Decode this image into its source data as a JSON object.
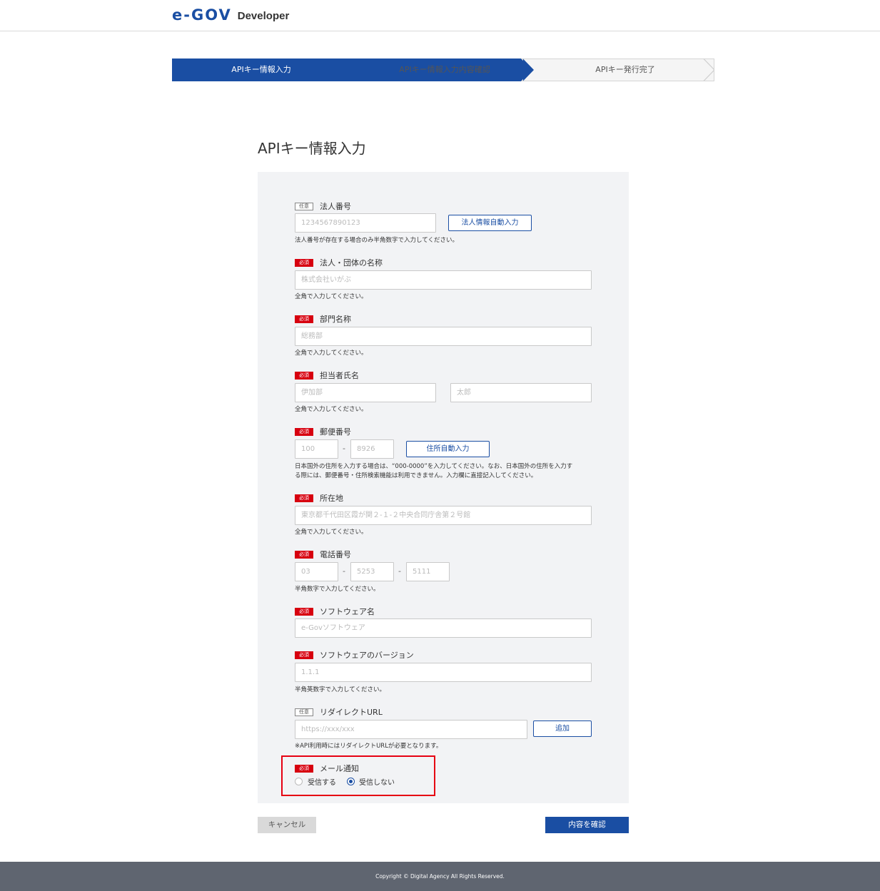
{
  "header": {
    "logo_mark": "e-GOV",
    "logo_sub": "Developer"
  },
  "stepper": {
    "steps": [
      {
        "label": "APIキー情報入力",
        "active": true
      },
      {
        "label": "APIキー情報入力内容確認",
        "active": false
      },
      {
        "label": "APIキー発行完了",
        "active": false
      }
    ]
  },
  "page_title": "APIキー情報入力",
  "badges": {
    "required": "必須",
    "optional": "任意"
  },
  "form": {
    "corporate_number": {
      "label": "法人番号",
      "placeholder": "1234567890123",
      "button": "法人情報自動入力",
      "help": "法人番号が存在する場合のみ半角数字で入力してください。"
    },
    "corporate_name": {
      "label": "法人・団体の名称",
      "placeholder": "株式会社いがぶ",
      "help": "全角で入力してください。"
    },
    "department": {
      "label": "部門名称",
      "placeholder": "総務部",
      "help": "全角で入力してください。"
    },
    "contact_name": {
      "label": "担当者氏名",
      "placeholder_last": "伊加部",
      "placeholder_first": "太郎",
      "help": "全角で入力してください。"
    },
    "postal_code": {
      "label": "郵便番号",
      "placeholder_1": "100",
      "placeholder_2": "8926",
      "separator": "-",
      "button": "住所自動入力",
      "help_1": "日本国外の住所を入力する場合は、“000-0000”を入力してください。なお、日本国外の住所を入力す",
      "help_2": "る際には、郵便番号・住所検索機能は利用できません。入力欄に直接記入してください。"
    },
    "address": {
      "label": "所在地",
      "placeholder": "東京都千代田区霞が関２-１-２中央合同庁舎第２号館",
      "help": "全角で入力してください。"
    },
    "phone": {
      "label": "電話番号",
      "placeholder_1": "03",
      "placeholder_2": "5253",
      "placeholder_3": "5111",
      "separator": "-",
      "help": "半角数字で入力してください。"
    },
    "software_name": {
      "label": "ソフトウェア名",
      "placeholder": "e-Govソフトウェア"
    },
    "software_version": {
      "label": "ソフトウェアのバージョン",
      "placeholder": "1.1.1",
      "help": "半角英数字で入力してください。"
    },
    "redirect_url": {
      "label": "リダイレクトURL",
      "placeholder": "https://xxx/xxx",
      "button": "追加",
      "help": "※API利用時にはリダイレクトURLが必要となります。"
    },
    "mail_notify": {
      "label": "メール通知",
      "option_receive": "受信する",
      "option_no_receive": "受信しない",
      "selected": "受信しない"
    }
  },
  "actions": {
    "cancel": "キャンセル",
    "confirm": "内容を確認"
  },
  "footer": {
    "copyright": "Copyright © Digital Agency All Rights Reserved."
  },
  "colors": {
    "primary": "#1a4ea3",
    "required_badge": "#d7000f",
    "highlight_border": "#e60012",
    "footer_bg": "#5f6570",
    "panel_bg": "#f2f3f5"
  }
}
